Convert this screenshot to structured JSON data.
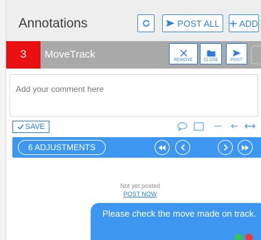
{
  "header": {
    "title": "Annotations",
    "post_all_label": "POST ALL",
    "add_label": "ADD"
  },
  "track": {
    "number": "3",
    "name": "MoveTrack",
    "remove_label": "REMOVE",
    "close_label": "CLOSE",
    "post_label": "POST"
  },
  "comment": {
    "placeholder": "Add your comment here"
  },
  "toolbar": {
    "save_label": "SAVE"
  },
  "nav": {
    "adjustments_label": "6 ADJUSTMENTS"
  },
  "message": {
    "status": "Not yet posted",
    "post_now_label": "POST NOW",
    "text": "Please check the move made on track."
  },
  "colors": {
    "accent": "#3d97f0",
    "link": "#2a7fd8",
    "track_number_bg": "#e81010",
    "track_bar_bg": "#a9a9a9",
    "header_bg": "#eeeeee"
  },
  "icons": {
    "refresh": "refresh-icon",
    "post_all": "send-icon",
    "add": "plus-icon",
    "remove": "close-icon",
    "close": "folder-icon",
    "post": "send-icon",
    "lock": "lock-icon",
    "save": "check-icon",
    "bubble": "speech-bubble-icon",
    "rect": "rectangle-icon",
    "line": "line-icon",
    "arrow": "arrow-left-icon",
    "double_arrow": "double-arrow-icon",
    "first": "fast-rewind-icon",
    "prev": "chevron-left-icon",
    "next": "chevron-right-icon",
    "last": "fast-forward-icon"
  }
}
